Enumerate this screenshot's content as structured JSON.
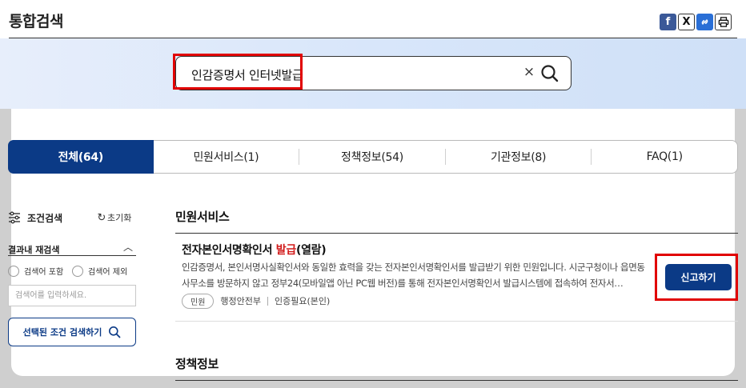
{
  "page": {
    "title": "통합검색"
  },
  "share": {
    "facebook_icon": "f",
    "x_icon": "X",
    "link_icon": "🔗",
    "print_icon": "🖨"
  },
  "search": {
    "query": "인감증명서 인터넷발급",
    "clear_icon": "×"
  },
  "tabs": [
    {
      "label": "전체(64)",
      "active": true
    },
    {
      "label": "민원서비스(1)",
      "active": false
    },
    {
      "label": "정책정보(54)",
      "active": false
    },
    {
      "label": "기관정보(8)",
      "active": false
    },
    {
      "label": "FAQ(1)",
      "active": false
    }
  ],
  "filter": {
    "title": "조건검색",
    "reset_label": "초기화",
    "rescan_title": "결과내 재검색",
    "include_label": "검색어 포함",
    "exclude_label": "검색어 제외",
    "input_placeholder": "검색어를 입력하세요.",
    "search_button": "선택된 조건 검색하기"
  },
  "sections": {
    "civil": "민원서비스",
    "policy": "정책정보"
  },
  "result": {
    "title_prefix": "전자본인서명확인서 ",
    "title_highlight": "발급",
    "title_suffix": "(열람)",
    "description": "인감증명서, 본인서명사실확인서와 동일한 효력을 갖는 전자본인서명확인서를 발급받기 위한 민원입니다. 시군구청이나 읍면동사무소를 방문하지 않고 정부24(모바일앱 아닌 PC웹 버전)를 통해 전자본인서명확인서 발급시스템에 접속하여 전자서…",
    "tag": "민원",
    "agency": "행정안전부",
    "requirement": "인증필요(본인)",
    "action_button": "신고하기"
  },
  "colors": {
    "primary": "#0b3a86",
    "highlight": "#e10000",
    "keyword": "#d11a1a"
  }
}
